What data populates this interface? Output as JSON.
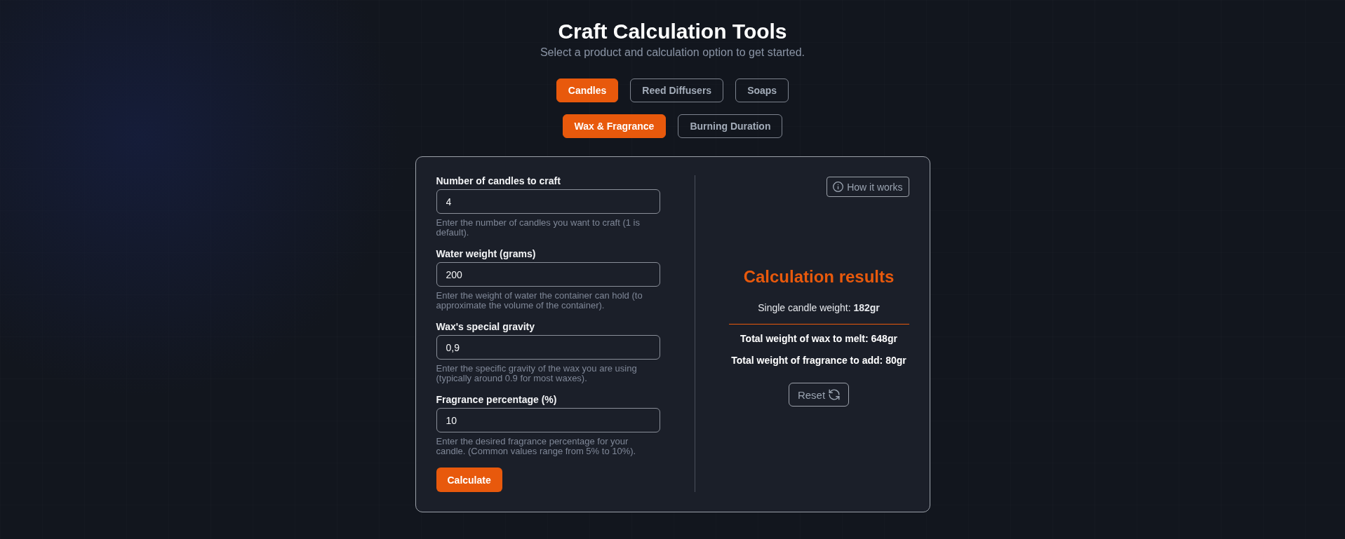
{
  "header": {
    "title": "Craft Calculation Tools",
    "subtitle": "Select a product and calculation option to get started."
  },
  "product_tabs": [
    {
      "label": "Candles",
      "selected": true
    },
    {
      "label": "Reed Diffusers",
      "selected": false
    },
    {
      "label": "Soaps",
      "selected": false
    }
  ],
  "calculation_tabs": [
    {
      "label": "Wax & Fragrance",
      "selected": true
    },
    {
      "label": "Burning Duration",
      "selected": false
    }
  ],
  "form": {
    "fields": [
      {
        "label": "Number of candles to craft",
        "value": "4",
        "help": "Enter the number of candles you want to craft (1 is default)."
      },
      {
        "label": "Water weight (grams)",
        "value": "200",
        "help": "Enter the weight of water the container can hold (to approximate the volume of the container)."
      },
      {
        "label": "Wax's special gravity",
        "value": "0,9",
        "help": "Enter the specific gravity of the wax you are using (typically around 0.9 for most waxes)."
      },
      {
        "label": "Fragrance percentage (%)",
        "value": "10",
        "help": "Enter the desired fragrance percentage for your candle. (Common values range from 5% to 10%)."
      }
    ],
    "submit_button": "Calculate"
  },
  "results": {
    "help_button": "How it works",
    "title": "Calculation results",
    "summary": "Single candle weight: **182gr**",
    "totals": [
      "Total weight of wax to melt: 648gr",
      "Total weight of fragrance to add: 80gr"
    ],
    "reset_button": "Reset"
  }
}
